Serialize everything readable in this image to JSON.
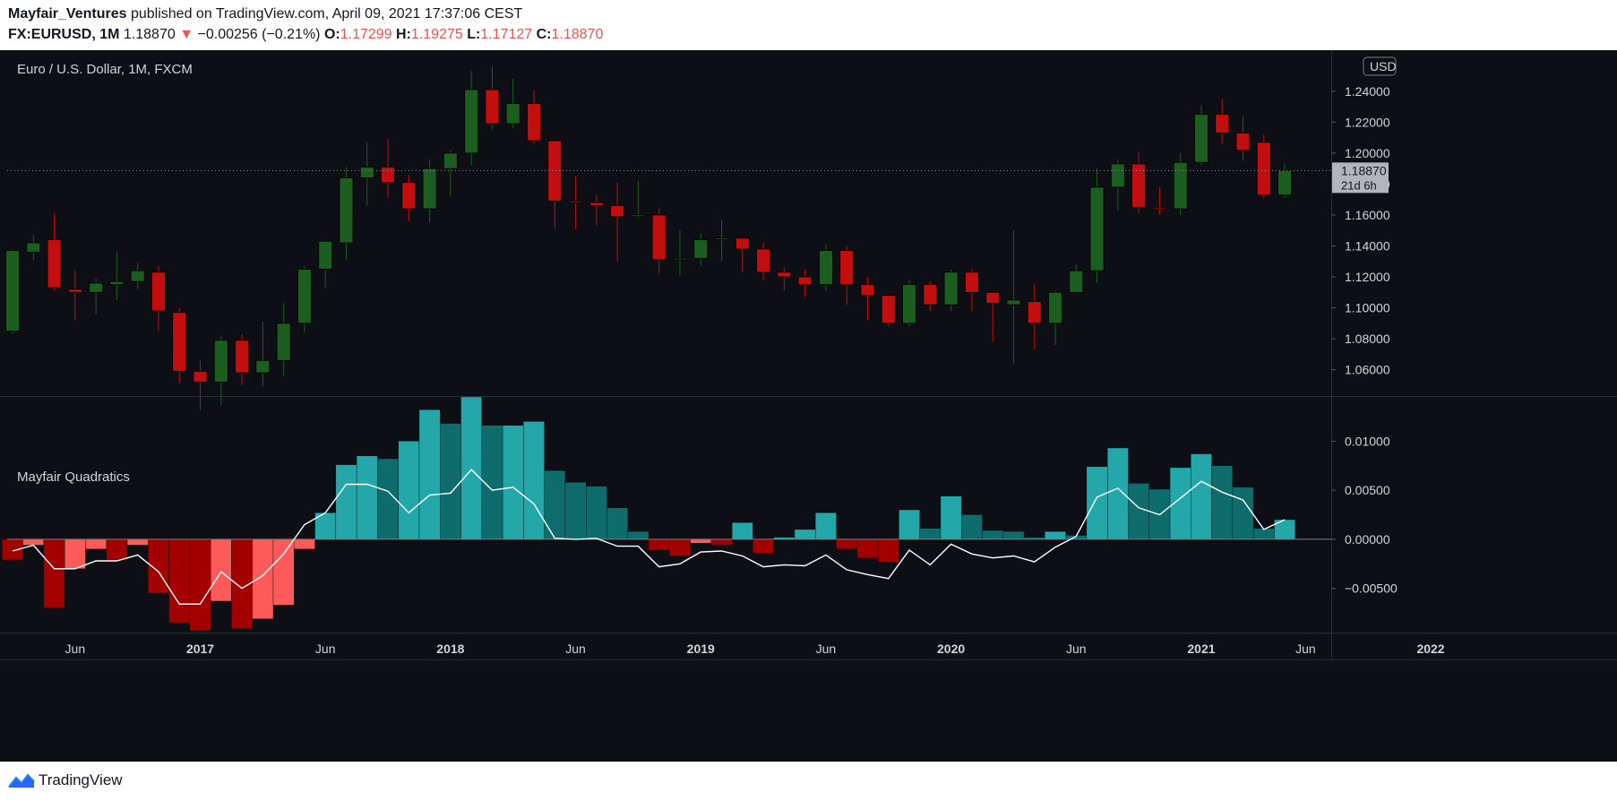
{
  "header": {
    "author": "Mayfair_Ventures",
    "published": "published on TradingView.com, April 09, 2021 17:37:06 CEST",
    "symbol": "FX:EURUSD, 1M",
    "last": "1.18870",
    "change_arrow": "▼",
    "change": "−0.00256 (−0.21%)",
    "o_label": "O:",
    "o_val": "1.17299",
    "h_label": "H:",
    "h_val": "1.19275",
    "l_label": "L:",
    "l_val": "1.17127",
    "c_label": "C:",
    "c_val": "1.18870"
  },
  "footer": {
    "brand": "TradingView",
    "logo_icon": "tradingview-logo-icon"
  },
  "colors": {
    "bg": "#0e0f14",
    "up": "#1b5e20",
    "down": "#c20e0e",
    "hist_pos_light": "#23a7a9",
    "hist_pos_dark": "#0f6c6c",
    "hist_neg_light": "#ff5a5a",
    "hist_neg_dark": "#a30000",
    "line": "#ffffff"
  },
  "chart_data": [
    {
      "type": "candlestick",
      "title": "Euro / U.S. Dollar, 1M, FXCM",
      "currency_badge": "USD",
      "price_tag": "1.18870",
      "countdown": "21d 6h",
      "price_ticks": [
        "1.06000",
        "1.08000",
        "1.10000",
        "1.12000",
        "1.14000",
        "1.16000",
        "1.18000",
        "1.20000",
        "1.22000",
        "1.24000"
      ],
      "x_ticks": [
        "Jun",
        "2017",
        "Jun",
        "2018",
        "Jun",
        "2019",
        "Jun",
        "2020",
        "Jun",
        "2021",
        "Jun",
        "2022"
      ],
      "x_tick_index": [
        3,
        9,
        15,
        21,
        27,
        33,
        39,
        45,
        51,
        57,
        62,
        68
      ],
      "ylim": [
        1.043,
        1.2665
      ],
      "last_price": 1.1887,
      "candles": [
        [
          1.085,
          1.138,
          1.083,
          1.137
        ],
        [
          1.136,
          1.147,
          1.131,
          1.142
        ],
        [
          1.144,
          1.161,
          1.111,
          1.113
        ],
        [
          1.112,
          1.124,
          1.092,
          1.11
        ],
        [
          1.11,
          1.119,
          1.096,
          1.116
        ],
        [
          1.115,
          1.136,
          1.105,
          1.117
        ],
        [
          1.117,
          1.129,
          1.112,
          1.124
        ],
        [
          1.123,
          1.127,
          1.085,
          1.098
        ],
        [
          1.097,
          1.1,
          1.051,
          1.059
        ],
        [
          1.059,
          1.066,
          1.034,
          1.052
        ],
        [
          1.052,
          1.082,
          1.037,
          1.079
        ],
        [
          1.079,
          1.083,
          1.05,
          1.058
        ],
        [
          1.058,
          1.091,
          1.049,
          1.066
        ],
        [
          1.066,
          1.103,
          1.056,
          1.09
        ],
        [
          1.09,
          1.127,
          1.084,
          1.125
        ],
        [
          1.125,
          1.144,
          1.113,
          1.143
        ],
        [
          1.142,
          1.191,
          1.131,
          1.184
        ],
        [
          1.184,
          1.207,
          1.166,
          1.191
        ],
        [
          1.191,
          1.209,
          1.171,
          1.181
        ],
        [
          1.181,
          1.186,
          1.156,
          1.164
        ],
        [
          1.164,
          1.196,
          1.155,
          1.19
        ],
        [
          1.19,
          1.202,
          1.172,
          1.2
        ],
        [
          1.2,
          1.253,
          1.192,
          1.241
        ],
        [
          1.241,
          1.256,
          1.215,
          1.219
        ],
        [
          1.219,
          1.248,
          1.216,
          1.232
        ],
        [
          1.232,
          1.241,
          1.206,
          1.208
        ],
        [
          1.208,
          1.205,
          1.151,
          1.169
        ],
        [
          1.169,
          1.185,
          1.151,
          1.168
        ],
        [
          1.168,
          1.173,
          1.153,
          1.166
        ],
        [
          1.166,
          1.181,
          1.13,
          1.159
        ],
        [
          1.159,
          1.182,
          1.158,
          1.16
        ],
        [
          1.16,
          1.165,
          1.122,
          1.131
        ],
        [
          1.131,
          1.15,
          1.121,
          1.132
        ],
        [
          1.132,
          1.148,
          1.127,
          1.144
        ],
        [
          1.144,
          1.157,
          1.13,
          1.145
        ],
        [
          1.145,
          1.145,
          1.123,
          1.138
        ],
        [
          1.138,
          1.142,
          1.118,
          1.123
        ],
        [
          1.123,
          1.126,
          1.111,
          1.12
        ],
        [
          1.12,
          1.125,
          1.107,
          1.115
        ],
        [
          1.115,
          1.141,
          1.111,
          1.137
        ],
        [
          1.137,
          1.14,
          1.102,
          1.115
        ],
        [
          1.115,
          1.12,
          1.092,
          1.108
        ],
        [
          1.108,
          1.104,
          1.088,
          1.09
        ],
        [
          1.09,
          1.118,
          1.088,
          1.115
        ],
        [
          1.115,
          1.117,
          1.098,
          1.102
        ],
        [
          1.102,
          1.125,
          1.098,
          1.123
        ],
        [
          1.123,
          1.125,
          1.098,
          1.11
        ],
        [
          1.11,
          1.11,
          1.078,
          1.103
        ],
        [
          1.102,
          1.15,
          1.064,
          1.105
        ],
        [
          1.104,
          1.115,
          1.073,
          1.09
        ],
        [
          1.09,
          1.111,
          1.076,
          1.11
        ],
        [
          1.11,
          1.128,
          1.11,
          1.124
        ],
        [
          1.124,
          1.19,
          1.116,
          1.178
        ],
        [
          1.178,
          1.196,
          1.163,
          1.193
        ],
        [
          1.193,
          1.201,
          1.161,
          1.165
        ],
        [
          1.165,
          1.178,
          1.16,
          1.164
        ],
        [
          1.164,
          1.2,
          1.16,
          1.194
        ],
        [
          1.194,
          1.231,
          1.192,
          1.225
        ],
        [
          1.225,
          1.235,
          1.206,
          1.213
        ],
        [
          1.213,
          1.224,
          1.195,
          1.202
        ],
        [
          1.207,
          1.212,
          1.171,
          1.173
        ],
        [
          1.173,
          1.193,
          1.171,
          1.1887
        ]
      ]
    },
    {
      "type": "bar",
      "title": "Mayfair Quadratics",
      "ticks": [
        "0.01000",
        "0.00500",
        "0.00000",
        "−0.00500"
      ],
      "ylim": [
        -0.0095,
        0.0145
      ],
      "histogram": [
        -0.0021,
        -0.0006,
        -0.007,
        -0.003,
        -0.001,
        -0.0021,
        -0.0006,
        -0.0055,
        -0.0085,
        -0.0093,
        -0.0063,
        -0.0091,
        -0.0081,
        -0.0067,
        -0.001,
        0.0027,
        0.0076,
        0.0085,
        0.0082,
        0.01,
        0.0132,
        0.0118,
        0.0145,
        0.0116,
        0.0116,
        0.012,
        0.007,
        0.0058,
        0.0054,
        0.0032,
        0.0008,
        -0.0011,
        -0.0017,
        -0.0004,
        -0.0006,
        0.0017,
        -0.0014,
        0.0002,
        0.001,
        0.0027,
        -0.001,
        -0.0019,
        -0.0023,
        0.003,
        0.0011,
        0.0044,
        0.0025,
        0.0009,
        0.0008,
        0.0002,
        0.0008,
        0.0004,
        0.0074,
        0.0093,
        0.0057,
        0.0051,
        0.0073,
        0.0087,
        0.0075,
        0.0053,
        0.0011,
        0.002
      ],
      "signal": [
        -0.0012,
        -0.0006,
        -0.003,
        -0.003,
        -0.0022,
        -0.0022,
        -0.0016,
        -0.0033,
        -0.0066,
        -0.0066,
        -0.0033,
        -0.005,
        -0.0037,
        -0.0015,
        0.0015,
        0.0027,
        0.0056,
        0.0056,
        0.0049,
        0.0027,
        0.0045,
        0.0047,
        0.0071,
        0.005,
        0.0053,
        0.0036,
        0.0001,
        0.0,
        0.0001,
        -0.0007,
        -0.0007,
        -0.0028,
        -0.0025,
        -0.0013,
        -0.0012,
        -0.0017,
        -0.0028,
        -0.0026,
        -0.0027,
        -0.0016,
        -0.0031,
        -0.0036,
        -0.004,
        -0.0011,
        -0.0026,
        -0.0005,
        -0.0015,
        -0.0019,
        -0.0017,
        -0.0023,
        -0.0008,
        0.0003,
        0.0043,
        0.0052,
        0.0032,
        0.0025,
        0.0042,
        0.0059,
        0.0048,
        0.004,
        0.001,
        0.002
      ]
    }
  ]
}
